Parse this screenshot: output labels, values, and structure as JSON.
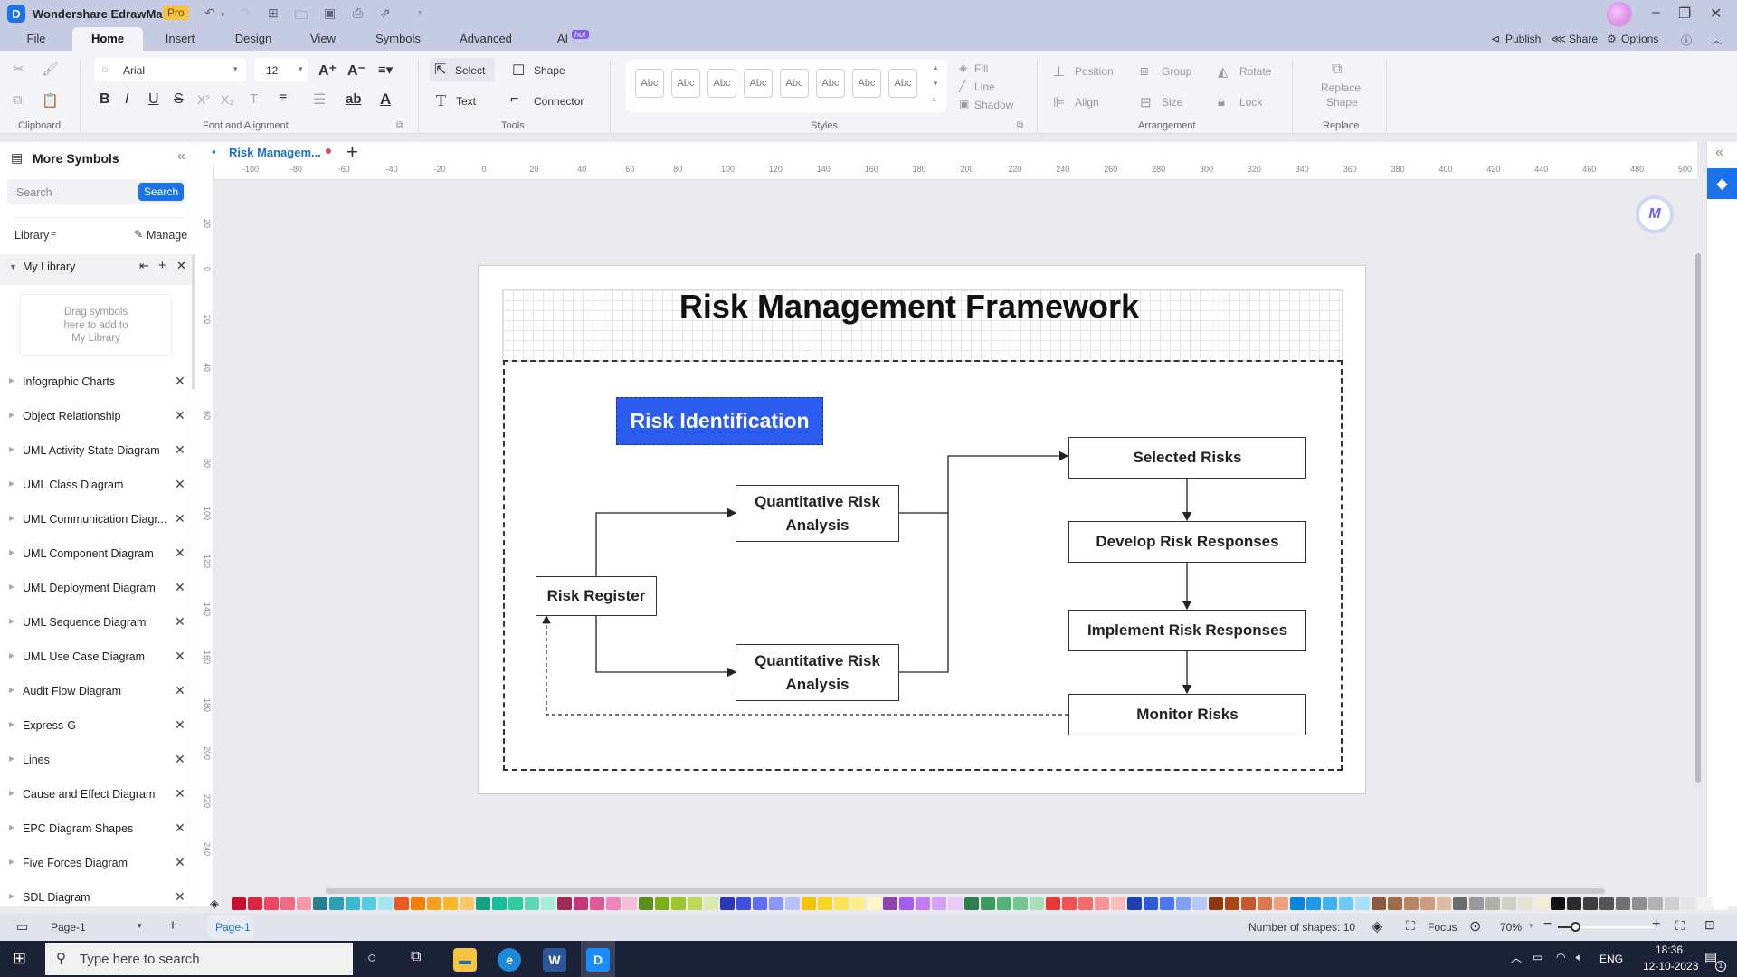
{
  "app": {
    "title": "Wondershare EdrawMax",
    "badge": "Pro",
    "user_avatar": "avatar"
  },
  "quick_access": [
    "undo-icon",
    "redo-icon",
    "new-icon",
    "open-icon",
    "save-icon",
    "print-icon",
    "export-icon",
    "customize-icon"
  ],
  "menu_tabs": [
    {
      "label": "File"
    },
    {
      "label": "Home",
      "active": true
    },
    {
      "label": "Insert"
    },
    {
      "label": "Design"
    },
    {
      "label": "View"
    },
    {
      "label": "Symbols"
    },
    {
      "label": "Advanced"
    },
    {
      "label": "AI",
      "badge": "hot"
    }
  ],
  "top_right": {
    "publish": "Publish",
    "share": "Share",
    "options": "Options"
  },
  "ribbon": {
    "clipboard": {
      "group_label": "Clipboard"
    },
    "font": {
      "group_label": "Font and Alignment",
      "font_name": "Arial",
      "font_size": "12",
      "buttons": [
        "B",
        "I",
        "U",
        "S",
        "X²",
        "X₂",
        "T",
        "≡",
        "☰",
        "ab",
        "A"
      ]
    },
    "tools": {
      "group_label": "Tools",
      "select": "Select",
      "shape": "Shape",
      "text": "Text",
      "connector": "Connector"
    },
    "styles": {
      "group_label": "Styles",
      "swatch_label": "Abc",
      "swatch_count": 8,
      "fill": "Fill",
      "line": "Line",
      "shadow": "Shadow"
    },
    "arrangement": {
      "group_label": "Arrangement",
      "position": "Position",
      "group": "Group",
      "rotate": "Rotate",
      "align": "Align",
      "size": "Size",
      "lock": "Lock"
    },
    "replace": {
      "group_label": "Replace",
      "replace_shape": "Replace",
      "replace_shape_2": "Shape"
    }
  },
  "left_panel": {
    "title": "More Symbols",
    "search_placeholder": "Search",
    "search_button": "Search",
    "library_label": "Library",
    "manage_label": "Manage",
    "my_library": "My Library",
    "drop_hint_1": "Drag symbols",
    "drop_hint_2": "here to add to",
    "drop_hint_3": "My Library",
    "libraries": [
      "Infographic Charts",
      "Object Relationship",
      "UML Activity State Diagram",
      "UML Class Diagram",
      "UML Communication Diagr...",
      "UML Component Diagram",
      "UML Deployment Diagram",
      "UML Sequence Diagram",
      "UML Use Case Diagram",
      "Audit Flow Diagram",
      "Express-G",
      "Lines",
      "Cause and Effect Diagram",
      "EPC Diagram Shapes",
      "Five Forces Diagram",
      "SDL Diagram"
    ]
  },
  "document_tab": {
    "label": "Risk Managem...",
    "unsaved": true
  },
  "rulers": {
    "horizontal": [
      "-100",
      "-80",
      "-60",
      "-40",
      "-20",
      "0",
      "20",
      "40",
      "60",
      "80",
      "100",
      "120",
      "140",
      "160",
      "180",
      "200",
      "220",
      "240",
      "260",
      "280",
      "300",
      "320",
      "340",
      "360",
      "380",
      "400",
      "420",
      "440",
      "460",
      "480",
      "500"
    ],
    "vertical": [
      "20",
      "0",
      "20",
      "40",
      "60",
      "80",
      "100",
      "120",
      "140",
      "160",
      "180",
      "200",
      "220",
      "240"
    ]
  },
  "diagram": {
    "title": "Risk Management Framework",
    "header": "Risk Identification",
    "header_color": "#2a5cf0",
    "nodes": {
      "risk_register": "Risk Register",
      "qra_top_1": "Quantitative Risk",
      "qra_top_2": "Analysis",
      "qra_bottom_1": "Quantitative Risk",
      "qra_bottom_2": "Analysis",
      "selected_risks": "Selected Risks",
      "develop": "Develop Risk Responses",
      "implement": "Implement Risk Responses",
      "monitor": "Monitor Risks"
    }
  },
  "palette": [
    "#c8102e",
    "#d7263d",
    "#e84a5f",
    "#f06c84",
    "#f59aa9",
    "#2a7f8f",
    "#2f9fb5",
    "#3bb7d0",
    "#55cce0",
    "#a5e7f0",
    "#ee5a24",
    "#f77f00",
    "#f79f1f",
    "#fbb829",
    "#fcc96a",
    "#16a085",
    "#1abc9c",
    "#2ecc9a",
    "#5ed6b8",
    "#a8ecd6",
    "#9b2c5c",
    "#c0397a",
    "#dd5a9b",
    "#ec88bd",
    "#f5bcd9",
    "#5a8f1e",
    "#7cae1f",
    "#9dc52c",
    "#bcd95a",
    "#dbebad",
    "#2c3ab1",
    "#3f51d6",
    "#5e6ef0",
    "#8b95f5",
    "#b9c0fa",
    "#f5c400",
    "#f9d423",
    "#fbe35a",
    "#fdee8c",
    "#fff7c2",
    "#8e44ad",
    "#a55eea",
    "#c47cf4",
    "#d6a2f7",
    "#e8cbfb",
    "#2e7d4f",
    "#3b9a60",
    "#52b376",
    "#74c692",
    "#a9dfb9",
    "#e53935",
    "#ef5350",
    "#f36c6c",
    "#f89595",
    "#fbbcbc",
    "#1e40af",
    "#2c5bd8",
    "#4b78ee",
    "#7ea0f5",
    "#b5c8fa",
    "#8b3a0e",
    "#a8471a",
    "#c45a2c",
    "#da7a4f",
    "#eaa27f",
    "#0a84d6",
    "#1f9be8",
    "#3fb1f2",
    "#6fc8f7",
    "#a7e0fb",
    "#8b5a3c",
    "#a26b48",
    "#b98460",
    "#cc9d7d",
    "#dfbba0",
    "#6d6d6d",
    "#999999",
    "#b0b0a8",
    "#cfcfc4",
    "#e5e3d6",
    "#f2ecd8",
    "#111111",
    "#2b2b2b",
    "#3f3f3f",
    "#555555",
    "#707070",
    "#8f8f8f",
    "#b2b2b2",
    "#cfcfcf",
    "#e4e4e4",
    "#f2f2f2",
    "#ffffff"
  ],
  "status_bar": {
    "page_selector": "Page-1",
    "page_tab": "Page-1",
    "shape_count": "Number of shapes: 10",
    "focus": "Focus",
    "zoom": "70%",
    "zoom_level_percent": 70
  },
  "taskbar": {
    "search_placeholder": "Type here to search",
    "language": "ENG",
    "time": "18:36",
    "date": "12-10-2023",
    "notification_count": "1"
  }
}
